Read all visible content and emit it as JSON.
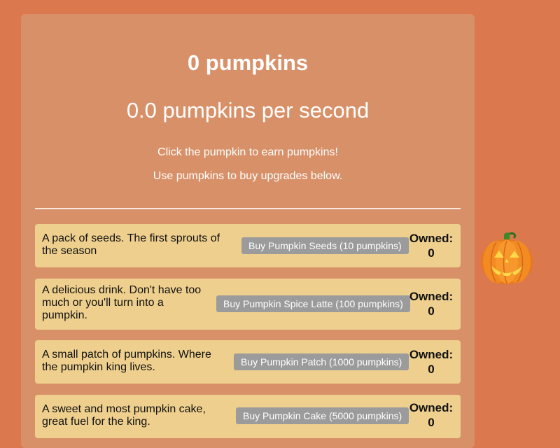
{
  "header": {
    "count": "0 pumpkins",
    "rate": "0.0 pumpkins per second",
    "hint_click": "Click the pumpkin to earn pumpkins!",
    "hint_buy": "Use pumpkins to buy upgrades below."
  },
  "upgrades": [
    {
      "description": "A pack of seeds. The first sprouts of the season",
      "button": "Buy Pumpkin Seeds (10 pumpkins)",
      "owned_label": "Owned:",
      "owned": "0"
    },
    {
      "description": "A delicious drink. Don't have too much or you'll turn into a pumpkin.",
      "button": "Buy Pumpkin Spice Latte (100 pumpkins)",
      "owned_label": "Owned:",
      "owned": "0"
    },
    {
      "description": "A small patch of pumpkins. Where the pumpkin king lives.",
      "button": "Buy Pumpkin Patch (1000 pumpkins)",
      "owned_label": "Owned:",
      "owned": "0"
    },
    {
      "description": "A sweet and most pumpkin cake, great fuel for the king.",
      "button": "Buy Pumpkin Cake (5000 pumpkins)",
      "owned_label": "Owned:",
      "owned": "0"
    }
  ],
  "clicker": {
    "icon": "jack-o-lantern-icon"
  },
  "colors": {
    "background": "#db784d",
    "panel": "#d89068",
    "upgrade_row": "#eecf8d",
    "button": "#9b9b9b",
    "pumpkin": "#f08a1c"
  }
}
